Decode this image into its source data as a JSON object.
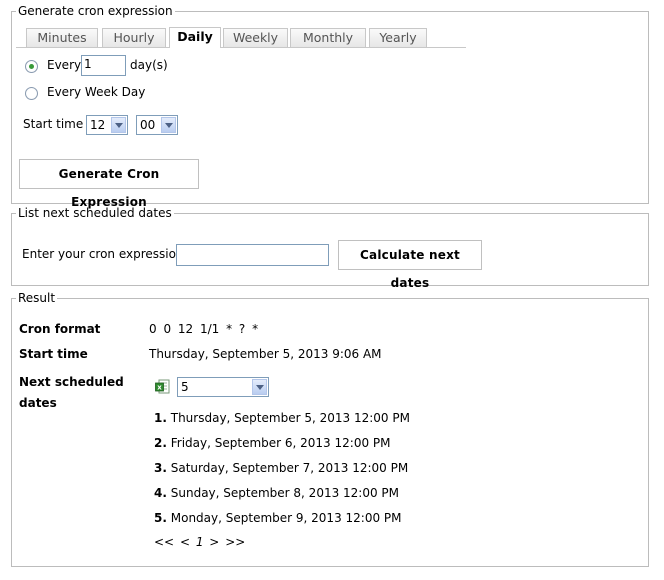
{
  "generate": {
    "legend": "Generate cron expression",
    "tabs": [
      "Minutes",
      "Hourly",
      "Daily",
      "Weekly",
      "Monthly",
      "Yearly"
    ],
    "active_tab": "Daily",
    "every_label": "Every",
    "every_value": "1",
    "day_suffix": "day(s)",
    "every_week_day_label": "Every Week Day",
    "start_time_label": "Start time",
    "hour_value": "12",
    "minute_value": "00",
    "button_label": "Generate Cron Expression"
  },
  "list": {
    "legend": "List next scheduled dates",
    "enter_label": "Enter your cron expression",
    "input_value": "",
    "button_label": "Calculate next dates"
  },
  "result": {
    "legend": "Result",
    "cron_format_label": "Cron format",
    "cron_format_value": "0 0 12 1/1 * ? *",
    "start_time_label": "Start time",
    "start_time_value": "Thursday, September 5, 2013 9:06 AM",
    "next_label_line1": "Next scheduled",
    "next_label_line2": "dates",
    "count_value": "5",
    "dates": [
      {
        "num": "1.",
        "text": "Thursday, September 5, 2013 12:00 PM"
      },
      {
        "num": "2.",
        "text": "Friday, September 6, 2013 12:00 PM"
      },
      {
        "num": "3.",
        "text": "Saturday, September 7, 2013 12:00 PM"
      },
      {
        "num": "4.",
        "text": "Sunday, September 8, 2013 12:00 PM"
      },
      {
        "num": "5.",
        "text": "Monday, September 9, 2013 12:00 PM"
      }
    ],
    "pager": {
      "first": "<<",
      "prev": "<",
      "page": "1",
      "next": ">",
      "last": ">>"
    }
  },
  "colors": {
    "border": "#bcbcbc",
    "radio_checked": "#3a9a3a",
    "input_border": "#7f9db9"
  },
  "icons": {
    "export": "excel-icon"
  }
}
